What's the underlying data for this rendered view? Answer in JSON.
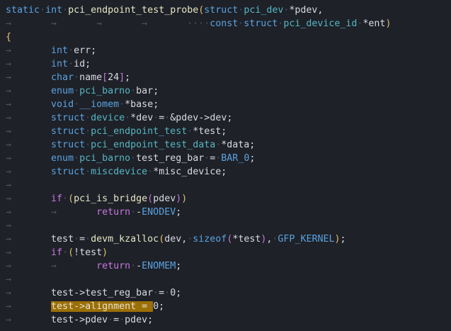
{
  "editor": {
    "lines": [
      [
        [
          "t-kw",
          "static"
        ],
        [
          "t-ws",
          "·"
        ],
        [
          "t-kw",
          "int"
        ],
        [
          "t-ws",
          "·"
        ],
        [
          "t-fn",
          "pci_endpoint_test_probe"
        ],
        [
          "t-paren",
          "("
        ],
        [
          "t-kw",
          "struct"
        ],
        [
          "t-ws",
          "·"
        ],
        [
          "t-ty",
          "pci_dev"
        ],
        [
          "t-ws",
          "·"
        ],
        [
          "t-op",
          "*"
        ],
        [
          "t-tx",
          "pdev,"
        ]
      ],
      [
        [
          "t-ws",
          "→       →       →       →       ····"
        ],
        [
          "t-kw",
          "const"
        ],
        [
          "t-ws",
          "·"
        ],
        [
          "t-kw",
          "struct"
        ],
        [
          "t-ws",
          "·"
        ],
        [
          "t-ty",
          "pci_device_id"
        ],
        [
          "t-ws",
          "·"
        ],
        [
          "t-op",
          "*"
        ],
        [
          "t-tx",
          "ent"
        ],
        [
          "t-paren",
          ")"
        ]
      ],
      [
        [
          "t-brace",
          "{"
        ]
      ],
      [
        [
          "t-ws",
          "→       "
        ],
        [
          "t-kw",
          "int"
        ],
        [
          "t-ws",
          "·"
        ],
        [
          "t-tx",
          "err;"
        ]
      ],
      [
        [
          "t-ws",
          "→       "
        ],
        [
          "t-kw",
          "int"
        ],
        [
          "t-ws",
          "·"
        ],
        [
          "t-tx",
          "id;"
        ]
      ],
      [
        [
          "t-ws",
          "→       "
        ],
        [
          "t-kw",
          "char"
        ],
        [
          "t-ws",
          "·"
        ],
        [
          "t-tx",
          "name"
        ],
        [
          "t-paren2",
          "["
        ],
        [
          "t-num",
          "24"
        ],
        [
          "t-paren2",
          "]"
        ],
        [
          "t-tx",
          ";"
        ]
      ],
      [
        [
          "t-ws",
          "→       "
        ],
        [
          "t-kw",
          "enum"
        ],
        [
          "t-ws",
          "·"
        ],
        [
          "t-ty",
          "pci_barno"
        ],
        [
          "t-ws",
          "·"
        ],
        [
          "t-tx",
          "bar;"
        ]
      ],
      [
        [
          "t-ws",
          "→       "
        ],
        [
          "t-kw",
          "void"
        ],
        [
          "t-ws",
          "·"
        ],
        [
          "t-kw",
          "__iomem"
        ],
        [
          "t-ws",
          "·"
        ],
        [
          "t-op",
          "*"
        ],
        [
          "t-tx",
          "base;"
        ]
      ],
      [
        [
          "t-ws",
          "→       "
        ],
        [
          "t-kw",
          "struct"
        ],
        [
          "t-ws",
          "·"
        ],
        [
          "t-ty",
          "device"
        ],
        [
          "t-ws",
          "·"
        ],
        [
          "t-op",
          "*"
        ],
        [
          "t-tx",
          "dev"
        ],
        [
          "t-ws",
          "·"
        ],
        [
          "t-op",
          "="
        ],
        [
          "t-ws",
          "·"
        ],
        [
          "t-op",
          "&"
        ],
        [
          "t-tx",
          "pdev->dev;"
        ]
      ],
      [
        [
          "t-ws",
          "→       "
        ],
        [
          "t-kw",
          "struct"
        ],
        [
          "t-ws",
          "·"
        ],
        [
          "t-ty",
          "pci_endpoint_test"
        ],
        [
          "t-ws",
          "·"
        ],
        [
          "t-op",
          "*"
        ],
        [
          "t-tx",
          "test;"
        ]
      ],
      [
        [
          "t-ws",
          "→       "
        ],
        [
          "t-kw",
          "struct"
        ],
        [
          "t-ws",
          "·"
        ],
        [
          "t-ty",
          "pci_endpoint_test_data"
        ],
        [
          "t-ws",
          "·"
        ],
        [
          "t-op",
          "*"
        ],
        [
          "t-tx",
          "data;"
        ]
      ],
      [
        [
          "t-ws",
          "→       "
        ],
        [
          "t-kw",
          "enum"
        ],
        [
          "t-ws",
          "·"
        ],
        [
          "t-ty",
          "pci_barno"
        ],
        [
          "t-ws",
          "·"
        ],
        [
          "t-tx",
          "test_reg_bar"
        ],
        [
          "t-ws",
          "·"
        ],
        [
          "t-op",
          "="
        ],
        [
          "t-ws",
          "·"
        ],
        [
          "t-const",
          "BAR_0"
        ],
        [
          "t-tx",
          ";"
        ]
      ],
      [
        [
          "t-ws",
          "→       "
        ],
        [
          "t-kw",
          "struct"
        ],
        [
          "t-ws",
          "·"
        ],
        [
          "t-ty",
          "miscdevice"
        ],
        [
          "t-ws",
          "·"
        ],
        [
          "t-op",
          "*"
        ],
        [
          "t-tx",
          "misc_device;"
        ]
      ],
      [
        [
          "t-ws",
          "→"
        ]
      ],
      [
        [
          "t-ws",
          "→       "
        ],
        [
          "t-kwc",
          "if"
        ],
        [
          "t-ws",
          "·"
        ],
        [
          "t-paren",
          "("
        ],
        [
          "t-fn",
          "pci_is_bridge"
        ],
        [
          "t-paren2",
          "("
        ],
        [
          "t-tx",
          "pdev"
        ],
        [
          "t-paren2",
          ")"
        ],
        [
          "t-paren",
          ")"
        ]
      ],
      [
        [
          "t-ws",
          "→       →       "
        ],
        [
          "t-kwc",
          "return"
        ],
        [
          "t-ws",
          "·"
        ],
        [
          "t-op",
          "-"
        ],
        [
          "t-const",
          "ENODEV"
        ],
        [
          "t-tx",
          ";"
        ]
      ],
      [
        [
          "t-ws",
          "→"
        ]
      ],
      [
        [
          "t-ws",
          "→       "
        ],
        [
          "t-tx",
          "test"
        ],
        [
          "t-ws",
          "·"
        ],
        [
          "t-op",
          "="
        ],
        [
          "t-ws",
          "·"
        ],
        [
          "t-fn",
          "devm_kzalloc"
        ],
        [
          "t-paren",
          "("
        ],
        [
          "t-tx",
          "dev,"
        ],
        [
          "t-ws",
          "·"
        ],
        [
          "t-kw",
          "sizeof"
        ],
        [
          "t-paren2",
          "("
        ],
        [
          "t-op",
          "*"
        ],
        [
          "t-tx",
          "test"
        ],
        [
          "t-paren2",
          ")"
        ],
        [
          "t-tx",
          ","
        ],
        [
          "t-ws",
          "·"
        ],
        [
          "t-const",
          "GFP_KERNEL"
        ],
        [
          "t-paren",
          ")"
        ],
        [
          "t-tx",
          ";"
        ]
      ],
      [
        [
          "t-ws",
          "→       "
        ],
        [
          "t-kwc",
          "if"
        ],
        [
          "t-ws",
          "·"
        ],
        [
          "t-paren",
          "("
        ],
        [
          "t-op",
          "!"
        ],
        [
          "t-tx",
          "test"
        ],
        [
          "t-paren",
          ")"
        ]
      ],
      [
        [
          "t-ws",
          "→       →       "
        ],
        [
          "t-kwc",
          "return"
        ],
        [
          "t-ws",
          "·"
        ],
        [
          "t-op",
          "-"
        ],
        [
          "t-const",
          "ENOMEM"
        ],
        [
          "t-tx",
          ";"
        ]
      ],
      [
        [
          "t-ws",
          "→"
        ]
      ],
      [
        [
          "t-ws",
          "→       "
        ],
        [
          "t-tx",
          "test->test_reg_bar"
        ],
        [
          "t-ws",
          "·"
        ],
        [
          "t-op",
          "="
        ],
        [
          "t-ws",
          "·"
        ],
        [
          "t-num",
          "0"
        ],
        [
          "t-tx",
          ";"
        ]
      ],
      [
        [
          "t-ws",
          "→       "
        ],
        [
          "t-hl",
          "test->alignment = "
        ],
        [
          "t-num",
          "0"
        ],
        [
          "t-tx",
          ";"
        ]
      ],
      [
        [
          "t-ws",
          "→       "
        ],
        [
          "t-tx",
          "test->pdev"
        ],
        [
          "t-ws",
          "·"
        ],
        [
          "t-op",
          "="
        ],
        [
          "t-ws",
          "·"
        ],
        [
          "t-tx",
          "pdev;"
        ]
      ],
      [
        [
          "t-ws",
          "→"
        ]
      ]
    ]
  }
}
